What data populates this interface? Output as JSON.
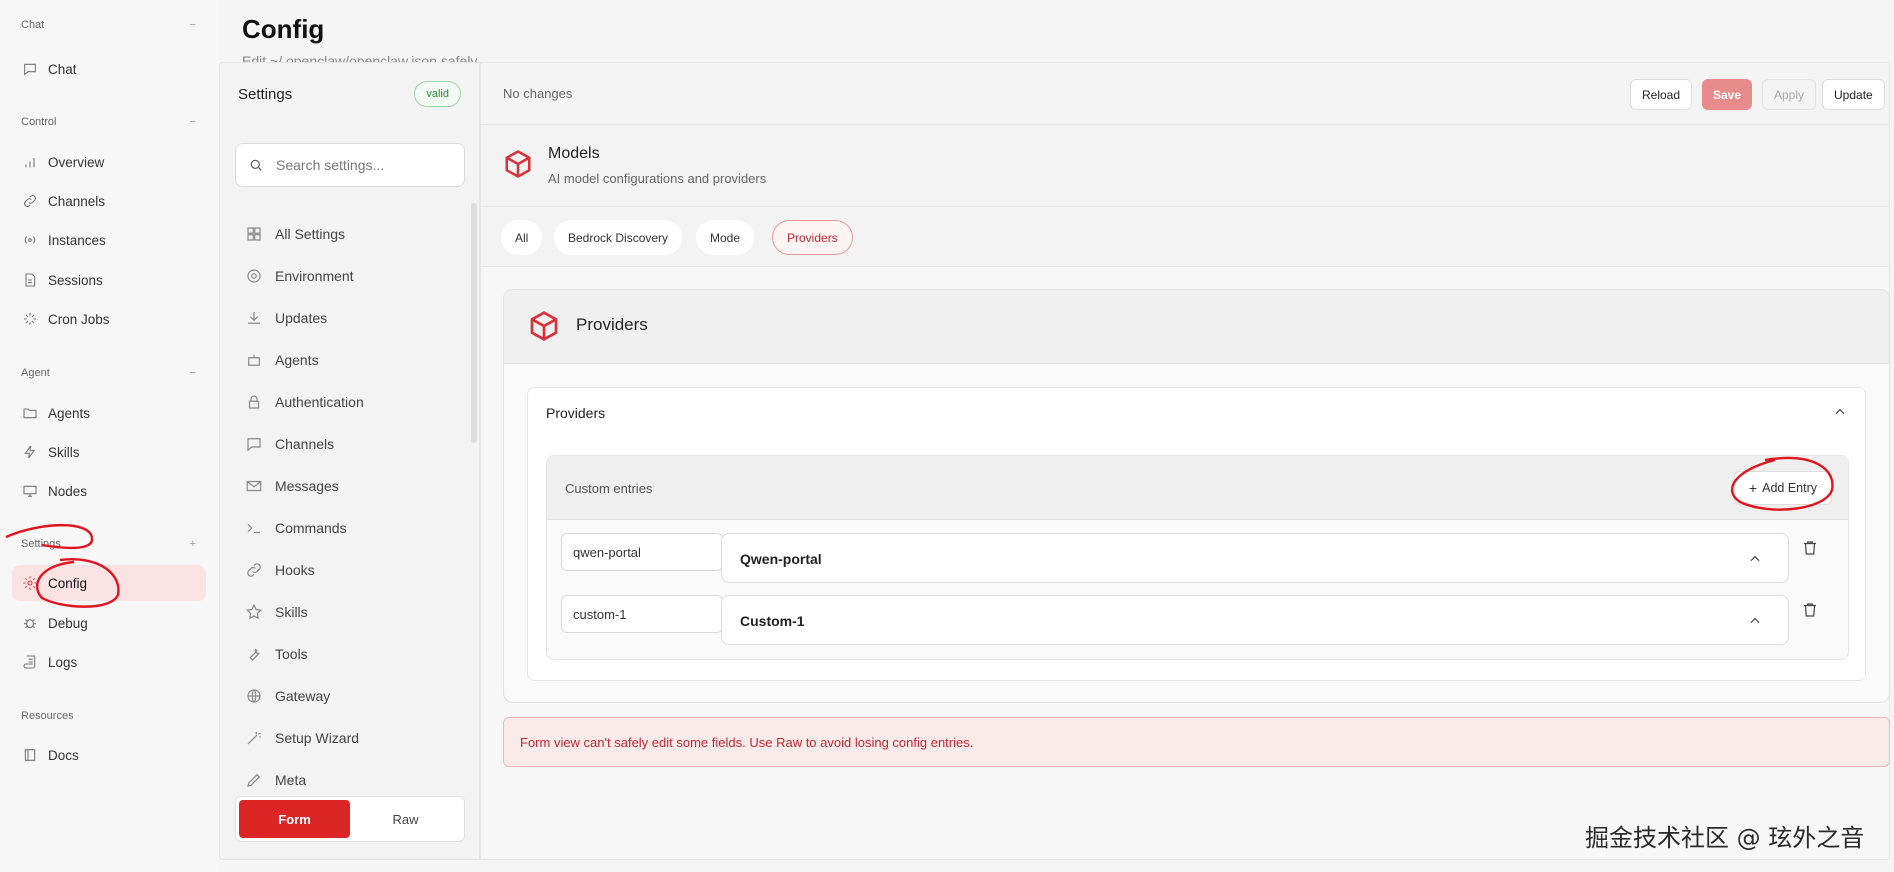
{
  "nav": {
    "groups": [
      {
        "title": "Chat",
        "toggle": "−"
      },
      {
        "title": "Control",
        "toggle": "−"
      },
      {
        "title": "Agent",
        "toggle": "−"
      },
      {
        "title": "Settings",
        "toggle": "+"
      },
      {
        "title": "Resources",
        "toggle": ""
      }
    ],
    "items": [
      {
        "label": "Chat",
        "icon": "message-icon"
      },
      {
        "label": "Overview",
        "icon": "bar-chart-icon"
      },
      {
        "label": "Channels",
        "icon": "link-icon"
      },
      {
        "label": "Instances",
        "icon": "radio-icon"
      },
      {
        "label": "Sessions",
        "icon": "document-icon"
      },
      {
        "label": "Cron Jobs",
        "icon": "loader-icon"
      },
      {
        "label": "Agents",
        "icon": "folder-icon"
      },
      {
        "label": "Skills",
        "icon": "zap-icon"
      },
      {
        "label": "Nodes",
        "icon": "monitor-icon"
      },
      {
        "label": "Config",
        "icon": "gear-icon",
        "active": true
      },
      {
        "label": "Debug",
        "icon": "bug-icon"
      },
      {
        "label": "Logs",
        "icon": "scroll-icon"
      },
      {
        "label": "Docs",
        "icon": "book-icon"
      }
    ]
  },
  "header": {
    "title": "Config",
    "subtitle": "Edit ~/.openclaw/openclaw.json safely"
  },
  "settings": {
    "title": "Settings",
    "valid_badge": "valid",
    "search_placeholder": "Search settings...",
    "items": [
      {
        "label": "All Settings",
        "icon": "grid-icon"
      },
      {
        "label": "Environment",
        "icon": "gear-icon"
      },
      {
        "label": "Updates",
        "icon": "download-icon"
      },
      {
        "label": "Agents",
        "icon": "robot-icon"
      },
      {
        "label": "Authentication",
        "icon": "lock-icon"
      },
      {
        "label": "Channels",
        "icon": "message-icon"
      },
      {
        "label": "Messages",
        "icon": "mail-icon"
      },
      {
        "label": "Commands",
        "icon": "terminal-icon"
      },
      {
        "label": "Hooks",
        "icon": "link-icon"
      },
      {
        "label": "Skills",
        "icon": "star-icon"
      },
      {
        "label": "Tools",
        "icon": "wrench-icon"
      },
      {
        "label": "Gateway",
        "icon": "globe-icon"
      },
      {
        "label": "Setup Wizard",
        "icon": "wand-icon"
      },
      {
        "label": "Meta",
        "icon": "pen-icon"
      }
    ],
    "mode": {
      "form": "Form",
      "raw": "Raw"
    }
  },
  "topbar": {
    "status": "No changes",
    "reload": "Reload",
    "save": "Save",
    "apply": "Apply",
    "update": "Update"
  },
  "section": {
    "title": "Models",
    "subtitle": "AI model configurations and providers"
  },
  "tabs": [
    "All",
    "Bedrock Discovery",
    "Mode",
    "Providers"
  ],
  "active_tab": "Providers",
  "card": {
    "title": "Providers",
    "inner_title": "Providers",
    "custom_title": "Custom entries",
    "add_entry": "Add Entry",
    "entries": [
      {
        "key": "qwen-portal",
        "label": "Qwen-portal"
      },
      {
        "key": "custom-1",
        "label": "Custom-1"
      }
    ]
  },
  "warning": "Form view can't safely edit some fields. Use Raw to avoid losing config entries.",
  "watermark": "掘金技术社区 @ 玹外之音",
  "colors": {
    "accent": "#dc2626",
    "valid": "#2f8a3e",
    "annotation": "#e0141e"
  }
}
